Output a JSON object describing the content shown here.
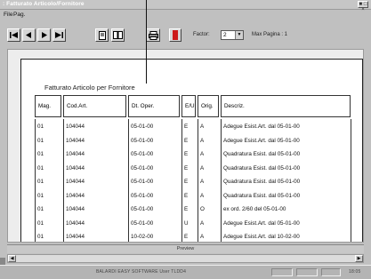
{
  "window": {
    "title": ": Fatturato Articolo/Fornitore",
    "control_label": "■ □ ×"
  },
  "menu": [
    "File",
    "Pag."
  ],
  "toolbar": {
    "factor_label": "Factor:",
    "factor_value": "2",
    "pages_label": "Max Pagina : 1"
  },
  "report": {
    "title": "Fatturato Articolo per Fornitore",
    "columns": [
      "Mag.",
      "Cod.Art.",
      "Dt. Oper.",
      "E/U",
      "Orig.",
      "Descriz."
    ],
    "rows": [
      [
        "01",
        "104044",
        "05-01-00",
        "E",
        "A",
        "Adegue Esist.Art. dal 05-01-00"
      ],
      [
        "01",
        "104044",
        "05-01-00",
        "E",
        "A",
        "Adegue Esist.Art. dal 05-01-00"
      ],
      [
        "01",
        "104044",
        "05-01-00",
        "E",
        "A",
        "Quadratura Esist. dal 05-01-00"
      ],
      [
        "01",
        "104044",
        "05-01-00",
        "E",
        "A",
        "Quadratura Esist. dal 05-01-00"
      ],
      [
        "01",
        "104044",
        "05-01-00",
        "E",
        "A",
        "Quadratura Esist. dal 05-01-00"
      ],
      [
        "01",
        "104044",
        "05-01-00",
        "E",
        "A",
        "Quadratura Esist. dal 05-01-00"
      ],
      [
        "01",
        "104044",
        "05-01-00",
        "E",
        "O",
        "ex ord. 2/60 del 05-01-00"
      ],
      [
        "01",
        "104044",
        "05-01-00",
        "U",
        "A",
        "Adegue Esist.Art. dal 05-01-00"
      ],
      [
        "01",
        "104044",
        "10-02-00",
        "E",
        "A",
        "Adegue Esist.Art. dal 10-02-00"
      ],
      [
        "01",
        "104044",
        "10-02-00",
        "E",
        "A",
        "Adegue Esist.Art. dal 10-02-00"
      ]
    ]
  },
  "status": {
    "preview_label": "Preview",
    "footer_text": "BALARDI EASY SOFTWARE    User TLDD4",
    "clock": "18:05"
  }
}
